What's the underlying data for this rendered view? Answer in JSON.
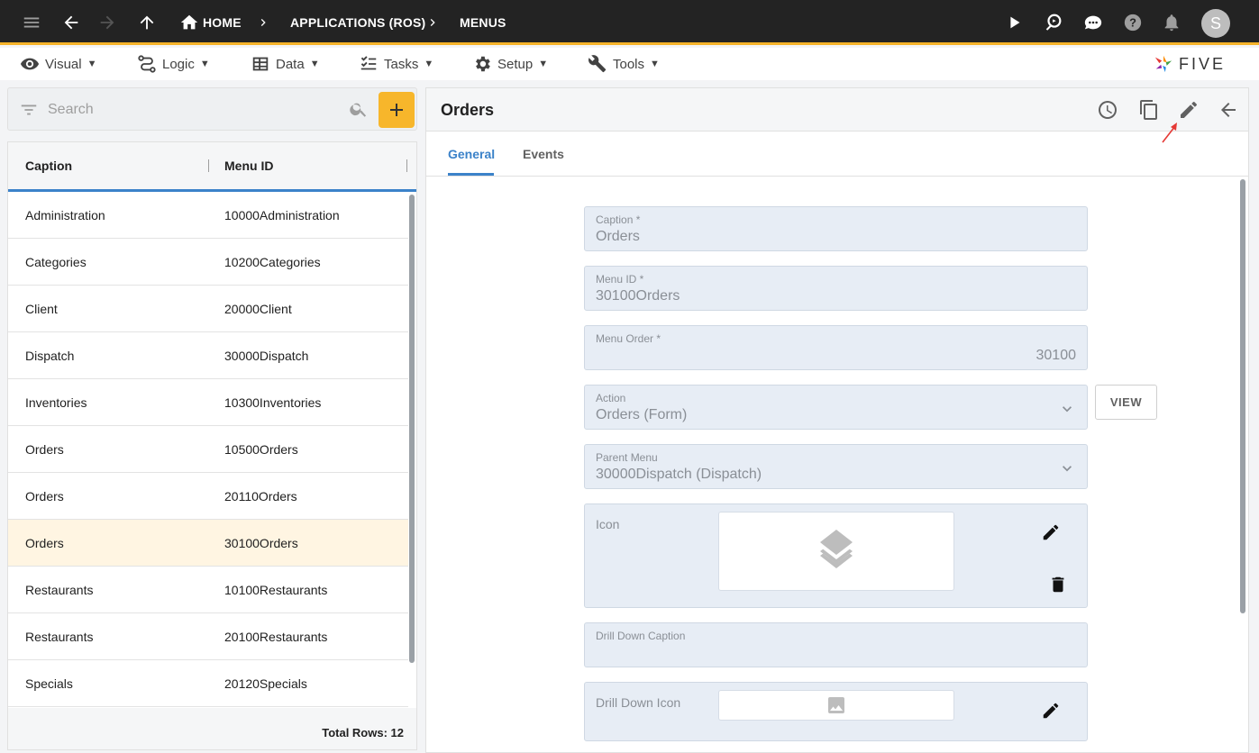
{
  "topbar": {
    "breadcrumbs": [
      "HOME",
      "APPLICATIONS (ROS)",
      "MENUS"
    ],
    "avatar_letter": "S"
  },
  "menubar": {
    "items": [
      "Visual",
      "Logic",
      "Data",
      "Tasks",
      "Setup",
      "Tools"
    ],
    "caret": "▼",
    "logo_text": "FIVE"
  },
  "search": {
    "placeholder": "Search"
  },
  "list": {
    "columns": [
      "Caption",
      "Menu ID"
    ],
    "rows": [
      {
        "caption": "Administration",
        "menu_id": "10000Administration"
      },
      {
        "caption": "Categories",
        "menu_id": "10200Categories"
      },
      {
        "caption": "Client",
        "menu_id": "20000Client"
      },
      {
        "caption": "Dispatch",
        "menu_id": "30000Dispatch"
      },
      {
        "caption": "Inventories",
        "menu_id": "10300Inventories"
      },
      {
        "caption": "Orders",
        "menu_id": "10500Orders"
      },
      {
        "caption": "Orders",
        "menu_id": "20110Orders"
      },
      {
        "caption": "Orders",
        "menu_id": "30100Orders"
      },
      {
        "caption": "Restaurants",
        "menu_id": "10100Restaurants"
      },
      {
        "caption": "Restaurants",
        "menu_id": "20100Restaurants"
      },
      {
        "caption": "Specials",
        "menu_id": "20120Specials"
      }
    ],
    "selected_index": 7,
    "total_rows": "Total Rows: 12"
  },
  "detail": {
    "title": "Orders",
    "tabs": [
      "General",
      "Events"
    ],
    "fields": {
      "caption": {
        "label": "Caption *",
        "value": "Orders"
      },
      "menu_id": {
        "label": "Menu ID *",
        "value": "30100Orders"
      },
      "menu_order": {
        "label": "Menu Order *",
        "value": "30100"
      },
      "action": {
        "label": "Action",
        "value": "Orders (Form)"
      },
      "parent_menu": {
        "label": "Parent Menu",
        "value": "30000Dispatch (Dispatch)"
      },
      "icon": {
        "label": "Icon"
      },
      "drill_down_caption": {
        "label": "Drill Down Caption",
        "value": ""
      },
      "drill_down_icon": {
        "label": "Drill Down Icon"
      }
    },
    "view_button": "VIEW"
  },
  "colors": {
    "accent": "#f7b62b",
    "tab_active": "#3b82c9",
    "topbar": "#232323"
  }
}
